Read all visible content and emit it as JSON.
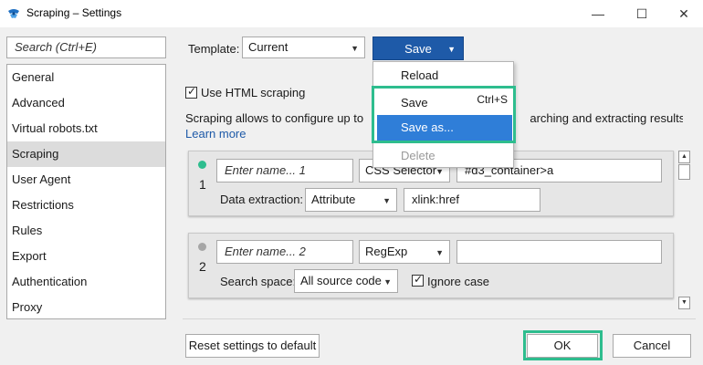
{
  "window": {
    "title": "Scraping – Settings",
    "minimize": "—",
    "maximize": "☐",
    "close": "✕"
  },
  "sidebar": {
    "search_placeholder": "Search (Ctrl+E)",
    "items": [
      {
        "label": "General"
      },
      {
        "label": "Advanced"
      },
      {
        "label": "Virtual robots.txt"
      },
      {
        "label": "Scraping"
      },
      {
        "label": "User Agent"
      },
      {
        "label": "Restrictions"
      },
      {
        "label": "Rules"
      },
      {
        "label": "Export"
      },
      {
        "label": "Authentication"
      },
      {
        "label": "Proxy"
      }
    ],
    "active_item": "Scraping"
  },
  "template": {
    "label": "Template:",
    "value": "Current",
    "save_label": "Save"
  },
  "menu": {
    "reload": "Reload",
    "save": "Save",
    "save_shortcut": "Ctrl+S",
    "save_as": "Save as...",
    "delete": "Delete"
  },
  "main": {
    "use_html_label": "Use HTML scraping",
    "use_html_checked": true,
    "desc_left": "Scraping allows to configure up to",
    "desc_right": "arching and extracting results.",
    "learn_more": "Learn more"
  },
  "rules": [
    {
      "number": "1",
      "status_color": "#2ebd8e",
      "name_placeholder": "Enter name... 1",
      "method": "CSS Selector",
      "query": "#d3_container>a",
      "sub_label": "Data extraction:",
      "sub_select": "Attribute",
      "sub_value": "xlink:href"
    },
    {
      "number": "2",
      "status_color": "#a6a6a6",
      "name_placeholder": "Enter name... 2",
      "method": "RegExp",
      "query": "",
      "sub_label": "Search space:",
      "sub_select": "All source code",
      "ignore_case_label": "Ignore case",
      "ignore_case_checked": true
    }
  ],
  "footer": {
    "reset": "Reset settings to default",
    "ok": "OK",
    "cancel": "Cancel"
  },
  "colors": {
    "accent": "#1e5aa8",
    "highlight": "#2ebd8e",
    "menu_selected": "#2f7ed8"
  }
}
